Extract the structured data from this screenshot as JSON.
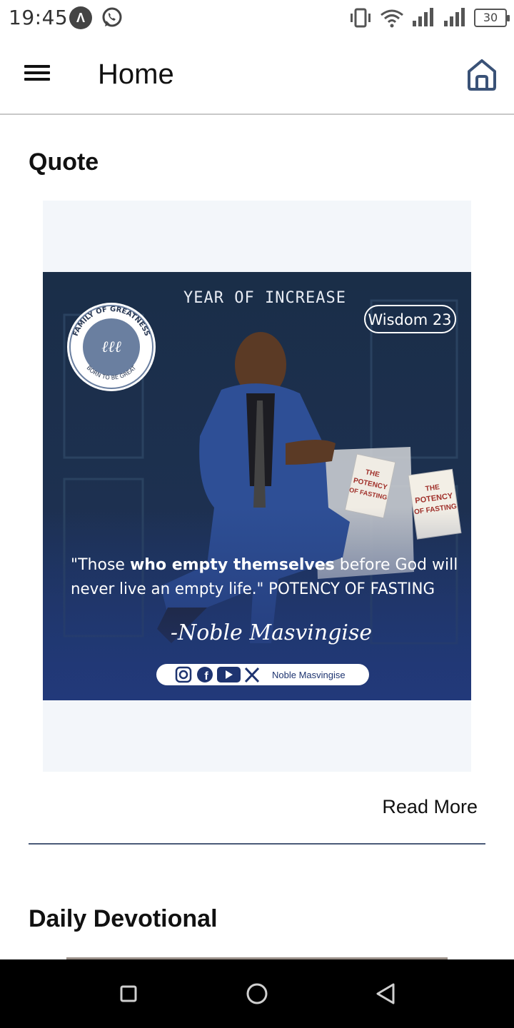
{
  "status_bar": {
    "time": "19:45",
    "battery": "30",
    "icons": [
      "app-a-icon",
      "whatsapp-icon",
      "vibrate-icon",
      "wifi-icon",
      "signal-icon",
      "signal-icon",
      "battery-icon"
    ]
  },
  "app_bar": {
    "title": "Home",
    "menu_icon": "hamburger-menu-icon",
    "home_icon": "home-icon"
  },
  "quote_section": {
    "title": "Quote",
    "image": {
      "header_text": "YEAR OF INCREASE",
      "badge": "Wisdom 23",
      "logo_top": "FAMILY OF GREATNESS",
      "logo_bottom": "BORN TO BE GREAT",
      "book_title_1": "THE POTENCY OF FASTING",
      "book_title_2": "THE POTENCY OF FASTING",
      "quote_open": "\"Those ",
      "quote_bold": "who empty themselves",
      "quote_rest_line1": " before God will",
      "quote_line2": "never live an empty life.\" POTENCY OF FASTING",
      "signature": "-Noble Masvingise",
      "social_handle": "Noble Masvingise",
      "social_icons": [
        "instagram-icon",
        "facebook-icon",
        "youtube-icon",
        "x-icon"
      ]
    },
    "read_more": "Read More"
  },
  "devotional_section": {
    "title": "Daily Devotional"
  },
  "colors": {
    "accent": "#3a5277",
    "divider": "#4a5a78",
    "card_bg": "#f3f6fa",
    "image_bg": "#16253f"
  },
  "nav_bar": {
    "icons": [
      "recent-apps-icon",
      "home-circle-icon",
      "back-icon"
    ]
  }
}
